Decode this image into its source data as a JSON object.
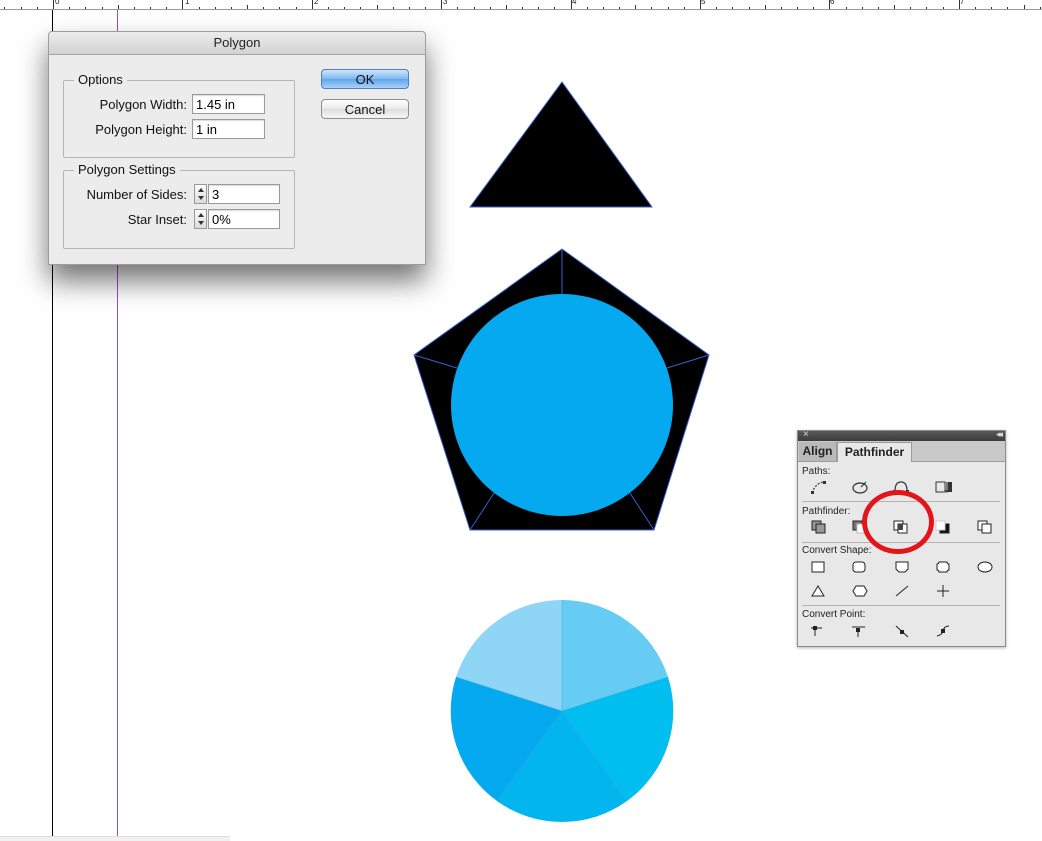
{
  "ruler": {
    "labels": [
      "0",
      "1",
      "2",
      "3",
      "4",
      "5",
      "6",
      "7"
    ]
  },
  "dialog": {
    "title": "Polygon",
    "options_legend": "Options",
    "width_label": "Polygon Width:",
    "width_value": "1.45 in",
    "height_label": "Polygon Height:",
    "height_value": "1 in",
    "settings_legend": "Polygon Settings",
    "sides_label": "Number of Sides:",
    "sides_value": "3",
    "inset_label": "Star Inset:",
    "inset_value": "0%",
    "ok_label": "OK",
    "cancel_label": "Cancel"
  },
  "panel": {
    "tabs": [
      "Align",
      "Pathfinder"
    ],
    "active_tab": "Pathfinder",
    "sections": {
      "paths": "Paths:",
      "pathfinder": "Pathfinder:",
      "convert_shape": "Convert Shape:",
      "convert_point": "Convert Point:"
    },
    "close_glyph": "×",
    "collapse_glyph": "◂◂"
  },
  "colors": {
    "shape_black": "#000000",
    "circle_blue": "#04a9ef",
    "guide_purple": "#a24bd0",
    "highlight_red": "#e3151a",
    "pie_slices": [
      "#8fd6f6",
      "#66ccf4",
      "#00bff0",
      "#02b5ef",
      "#04a9ef"
    ]
  },
  "icons": {
    "paths": [
      "join-path-icon",
      "open-path-icon",
      "close-path-icon",
      "reverse-path-icon"
    ],
    "pathfinder": [
      "add-icon",
      "subtract-icon",
      "intersect-icon",
      "exclude-overlap-icon",
      "minus-back-icon"
    ],
    "convert_shape": [
      "rectangle-icon",
      "rounded-rectangle-icon",
      "beveled-rectangle-icon",
      "inverse-rounded-rectangle-icon",
      "ellipse-icon",
      "triangle-icon",
      "polygon-icon",
      "line-icon",
      "orthogonal-line-icon"
    ],
    "convert_point": [
      "plain-point-icon",
      "corner-point-icon",
      "smooth-point-icon",
      "symmetrical-point-icon"
    ]
  }
}
